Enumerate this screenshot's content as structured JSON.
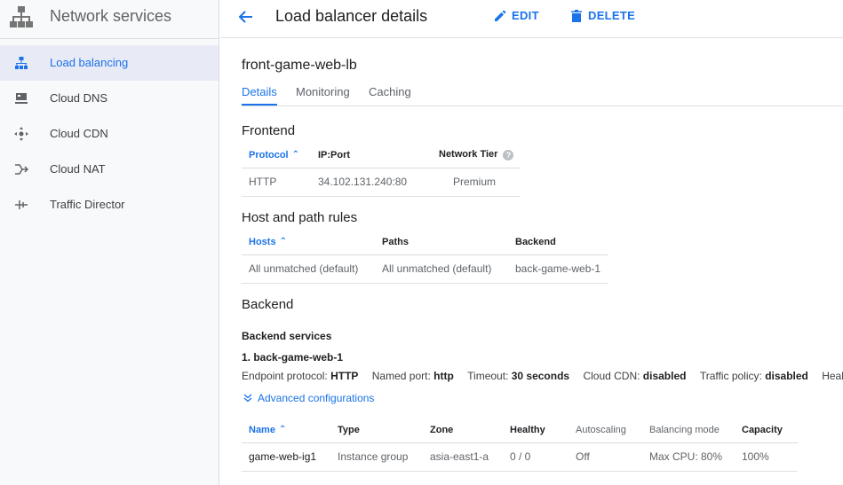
{
  "sidebar": {
    "title": "Network services",
    "items": [
      {
        "label": "Load balancing",
        "icon": "load-balancing-icon",
        "active": true
      },
      {
        "label": "Cloud DNS",
        "icon": "dns-icon",
        "active": false
      },
      {
        "label": "Cloud CDN",
        "icon": "cdn-icon",
        "active": false
      },
      {
        "label": "Cloud NAT",
        "icon": "nat-icon",
        "active": false
      },
      {
        "label": "Traffic Director",
        "icon": "traffic-director-icon",
        "active": false
      }
    ]
  },
  "header": {
    "title": "Load balancer details",
    "edit_label": "EDIT",
    "delete_label": "DELETE"
  },
  "main": {
    "lb_name": "front-game-web-lb",
    "tabs": [
      {
        "label": "Details",
        "active": true
      },
      {
        "label": "Monitoring",
        "active": false
      },
      {
        "label": "Caching",
        "active": false
      }
    ],
    "frontend": {
      "title": "Frontend",
      "headers": {
        "protocol": "Protocol",
        "ipport": "IP:Port",
        "tier": "Network Tier"
      },
      "row": {
        "protocol": "HTTP",
        "ipport": "34.102.131.240:80",
        "tier": "Premium"
      }
    },
    "host_path": {
      "title": "Host and path rules",
      "headers": {
        "hosts": "Hosts",
        "paths": "Paths",
        "backend": "Backend"
      },
      "row": {
        "hosts": "All unmatched (default)",
        "paths": "All unmatched (default)",
        "backend": "back-game-web-1"
      }
    },
    "backend": {
      "title": "Backend",
      "services_title": "Backend services",
      "service_name": "1. back-game-web-1",
      "props": [
        {
          "k": "Endpoint protocol: ",
          "v": "HTTP"
        },
        {
          "k": "Named port: ",
          "v": "http"
        },
        {
          "k": "Timeout: ",
          "v": "30 seconds"
        },
        {
          "k": "Cloud CDN: ",
          "v": "disabled"
        },
        {
          "k": "Traffic policy: ",
          "v": "disabled"
        },
        {
          "k": "Health c",
          "v": ""
        }
      ],
      "advanced_label": "Advanced configurations",
      "headers": {
        "name": "Name",
        "type": "Type",
        "zone": "Zone",
        "healthy": "Healthy",
        "autoscaling": "Autoscaling",
        "mode": "Balancing mode",
        "capacity": "Capacity"
      },
      "row": {
        "name": "game-web-ig1",
        "type": "Instance group",
        "zone": "asia-east1-a",
        "healthy": "0 / 0",
        "autoscaling": "Off",
        "mode": "Max CPU: 80%",
        "capacity": "100%"
      }
    }
  },
  "colors": {
    "accent": "#1a73e8",
    "sidebar_bg": "#f8f9fa",
    "active_bg": "#e8eaf6"
  }
}
